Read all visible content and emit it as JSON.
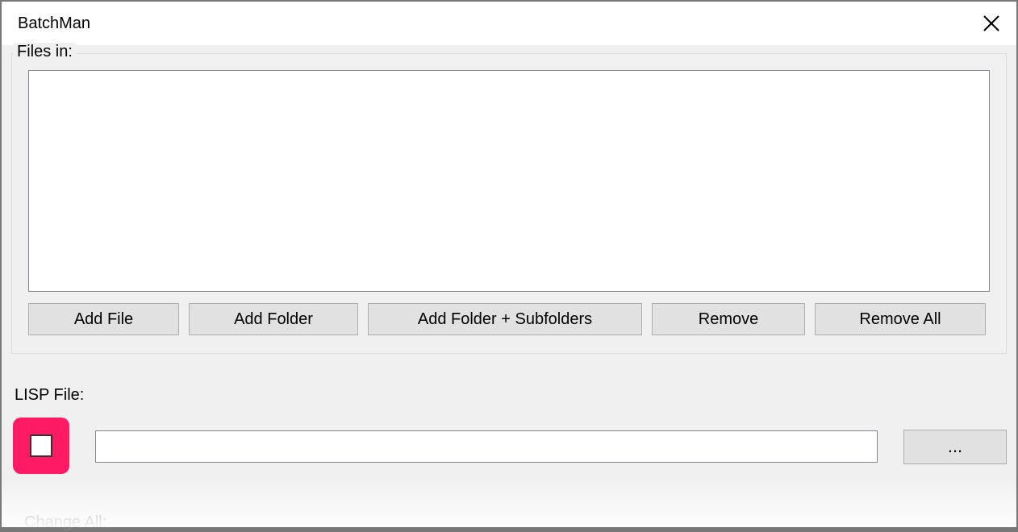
{
  "window": {
    "title": "BatchMan"
  },
  "filesGroup": {
    "label": "Files in:",
    "buttons": {
      "addFile": "Add File",
      "addFolder": "Add Folder",
      "addFolderSub": "Add Folder + Subfolders",
      "remove": "Remove",
      "removeAll": "Remove All"
    }
  },
  "lispSection": {
    "label": "LISP File:",
    "path": "",
    "browseLabel": "..."
  },
  "changeAll": {
    "label": "Change All:"
  }
}
